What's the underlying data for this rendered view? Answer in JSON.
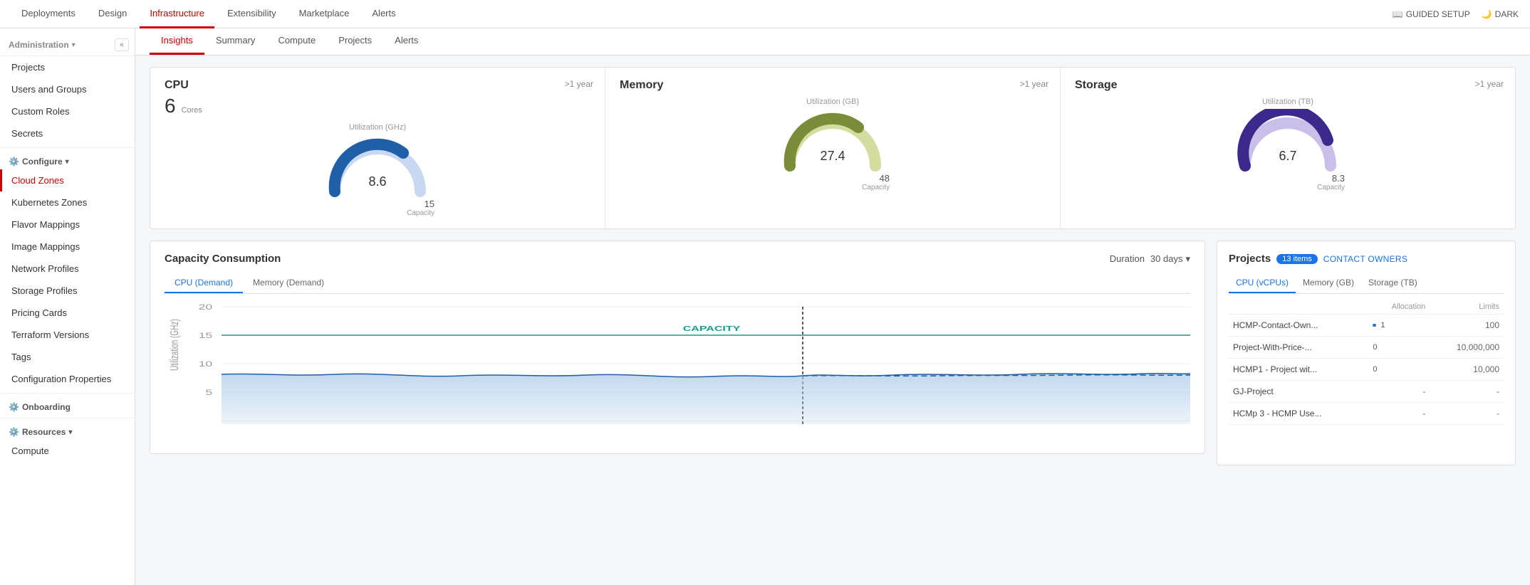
{
  "topNav": {
    "items": [
      {
        "label": "Deployments",
        "active": false
      },
      {
        "label": "Design",
        "active": false
      },
      {
        "label": "Infrastructure",
        "active": true
      },
      {
        "label": "Extensibility",
        "active": false
      },
      {
        "label": "Marketplace",
        "active": false
      },
      {
        "label": "Alerts",
        "active": false
      }
    ],
    "guidedSetup": "GUIDED SETUP",
    "dark": "DARK"
  },
  "sidebar": {
    "collapseBtn": "«",
    "sections": [
      {
        "name": "Administration",
        "items": [
          {
            "label": "Projects",
            "active": false
          },
          {
            "label": "Users and Groups",
            "active": false
          },
          {
            "label": "Custom Roles",
            "active": false
          },
          {
            "label": "Secrets",
            "active": false
          }
        ]
      },
      {
        "name": "Configure",
        "items": [
          {
            "label": "Cloud Zones",
            "active": true
          },
          {
            "label": "Kubernetes Zones",
            "active": false
          },
          {
            "label": "Flavor Mappings",
            "active": false
          },
          {
            "label": "Image Mappings",
            "active": false
          },
          {
            "label": "Network Profiles",
            "active": false
          },
          {
            "label": "Storage Profiles",
            "active": false
          },
          {
            "label": "Pricing Cards",
            "active": false
          },
          {
            "label": "Terraform Versions",
            "active": false
          },
          {
            "label": "Tags",
            "active": false
          },
          {
            "label": "Configuration Properties",
            "active": false
          }
        ]
      },
      {
        "name": "Onboarding",
        "items": []
      },
      {
        "name": "Resources",
        "items": [
          {
            "label": "Compute",
            "active": false
          }
        ]
      }
    ]
  },
  "subNav": {
    "items": [
      {
        "label": "Insights",
        "active": true
      },
      {
        "label": "Summary",
        "active": false
      },
      {
        "label": "Compute",
        "active": false
      },
      {
        "label": "Projects",
        "active": false
      },
      {
        "label": "Alerts",
        "active": false
      }
    ]
  },
  "metrics": [
    {
      "title": "CPU",
      "duration": ">1 year",
      "bigNum": "6",
      "bigLabel": "Cores",
      "gaugeUtilLabel": "Utilization (GHz)",
      "gaugeValue": "8.6",
      "gaugeCapacity": "15",
      "gaugeCapacityLabel": "Capacity",
      "gaugeColor": "#1e5fa8",
      "gaugeBgColor": "#c8d8f0"
    },
    {
      "title": "Memory",
      "duration": ">1 year",
      "bigNum": "",
      "bigLabel": "",
      "gaugeUtilLabel": "Utilization (GB)",
      "gaugeValue": "27.4",
      "gaugeCapacity": "48",
      "gaugeCapacityLabel": "Capacity",
      "gaugeColor": "#7a8c3a",
      "gaugeBgColor": "#d4dca0"
    },
    {
      "title": "Storage",
      "duration": ">1 year",
      "bigNum": "",
      "bigLabel": "",
      "gaugeUtilLabel": "Utilization (TB)",
      "gaugeValue": "6.7",
      "gaugeCapacity": "8.3",
      "gaugeCapacityLabel": "Capacity",
      "gaugeColor": "#3b2a8c",
      "gaugeBgColor": "#c8c0e8"
    }
  ],
  "capacityConsumption": {
    "title": "Capacity Consumption",
    "durationLabel": "Duration",
    "durationValue": "30 days",
    "tabs": [
      {
        "label": "CPU (Demand)",
        "active": true
      },
      {
        "label": "Memory (Demand)",
        "active": false
      }
    ],
    "yAxis": [
      "20",
      "15",
      "10",
      "5"
    ],
    "yAxisLabel": "Utilization (GHz)",
    "capacityLineLabel": "CAPACITY",
    "capacityLineValue": 15
  },
  "projects": {
    "title": "Projects",
    "badgeCount": "13 items",
    "contactOwners": "CONTACT OWNERS",
    "tabs": [
      {
        "label": "CPU (vCPUs)",
        "active": true
      },
      {
        "label": "Memory (GB)",
        "active": false
      },
      {
        "label": "Storage (TB)",
        "active": false
      }
    ],
    "columns": {
      "name": "",
      "allocation": "Allocation",
      "limits": "Limits"
    },
    "rows": [
      {
        "name": "HCMP-Contact-Own...",
        "allocationVal": "1",
        "allocationWidth": 5,
        "limitVal": "100"
      },
      {
        "name": "Project-With-Price-...",
        "allocationVal": "0",
        "allocationWidth": 0,
        "limitVal": "10,000,000"
      },
      {
        "name": "HCMP1 - Project wit...",
        "allocationVal": "0",
        "allocationWidth": 0,
        "limitVal": "10,000"
      },
      {
        "name": "GJ-Project",
        "allocationVal": "-",
        "allocationWidth": 0,
        "limitVal": "-"
      },
      {
        "name": "HCMp 3 - HCMP Use...",
        "allocationVal": "-",
        "allocationWidth": 0,
        "limitVal": "-"
      }
    ]
  }
}
